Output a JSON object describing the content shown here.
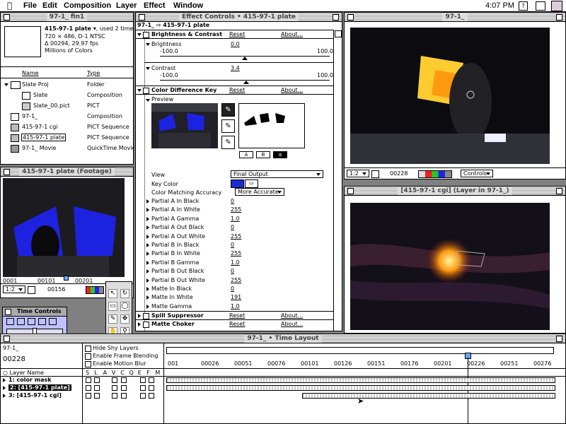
{
  "menubar": {
    "items": [
      "File",
      "Edit",
      "Composition",
      "Layer",
      "Effect",
      "Window"
    ],
    "clock": "4:07 PM"
  },
  "project": {
    "title": "97-1_ fin1",
    "selected_name": "415-97-1 plate",
    "used_times": ", used 2 times",
    "info_size": "720 × 486, D-1 NTSC",
    "info_duration": "Δ 00294, 29.97 fps",
    "info_colors": "Millions of Colors",
    "col_name": "Name",
    "col_type": "Type",
    "items": [
      {
        "name": "Slate Proj",
        "type": "Folder"
      },
      {
        "name": "Slate",
        "type": "Composition"
      },
      {
        "name": "Slate_00.pict",
        "type": "PICT"
      },
      {
        "name": "97-1_",
        "type": "Composition"
      },
      {
        "name": "415-97-1 cgi",
        "type": "PICT Sequence"
      },
      {
        "name": "415-97-1 plate",
        "type": "PICT Sequence"
      },
      {
        "name": "97-1_ Movie",
        "type": "QuickTime Movie"
      }
    ]
  },
  "footage": {
    "title": "415-97-1 plate (Footage)",
    "ruler": [
      "0001",
      "00101",
      "00201"
    ],
    "zoom": "1:2",
    "frame": "00156"
  },
  "time_controls": {
    "title": "Time Controls"
  },
  "effect_controls": {
    "title": "Effect Controls • 415-97-1 plate",
    "path": "97-1_ ⇨ 415-97-1 plate",
    "reset": "Reset",
    "about": "About...",
    "brightness": {
      "name": "Brightness & Contrast",
      "brightness_label": "Brightness",
      "brightness_value": "0.0",
      "contrast_label": "Contrast",
      "contrast_value": "3.4",
      "min": "-100.0",
      "max": "100.0"
    },
    "cdk": {
      "name": "Color Difference Key",
      "preview_label": "Preview",
      "buttons": [
        "A",
        "B",
        "α"
      ],
      "view_label": "View",
      "view_value": "Final Output",
      "key_color_label": "Key Color",
      "key_color": "#1a2bd6",
      "cma_label": "Color Matching Accuracy",
      "cma_value": "More Accurate",
      "params": [
        {
          "name": "Partial A In Black",
          "value": "0"
        },
        {
          "name": "Partial A In White",
          "value": "255"
        },
        {
          "name": "Partial A Gamma",
          "value": "1.0"
        },
        {
          "name": "Partial A Out Black",
          "value": "0"
        },
        {
          "name": "Partial A Out White",
          "value": "255"
        },
        {
          "name": "Partial B In Black",
          "value": "0"
        },
        {
          "name": "Partial B In White",
          "value": "255"
        },
        {
          "name": "Partial B Gamma",
          "value": "1.0"
        },
        {
          "name": "Partial B Out Black",
          "value": "0"
        },
        {
          "name": "Partial B Out White",
          "value": "255"
        },
        {
          "name": "Matte In Black",
          "value": "0"
        },
        {
          "name": "Matte In White",
          "value": "191"
        },
        {
          "name": "Matte Gamma",
          "value": "1.0"
        }
      ]
    },
    "spill": "Spill Suppressor",
    "choker": "Matte Choker"
  },
  "comp_window": {
    "title": "97-1_",
    "zoom": "1:2",
    "frame": "00228",
    "controls": "Controls"
  },
  "layer_window": {
    "title": "[415-97-1 cgi] (Layer in 97-1_)"
  },
  "timeline": {
    "title": "97-1_ • Time Layout",
    "comp_name": "97-1_",
    "current_frame": "00228",
    "options": [
      "Hide Shy Layers",
      "Enable Frame Blending",
      "Enable Motion Blur"
    ],
    "layer_name_header": "Layer Name",
    "switch_headers": [
      "S",
      "L",
      "A",
      "V",
      "C",
      "Q",
      "E",
      "F",
      "M"
    ],
    "layers": [
      "1: color mask",
      "2: [415-97-1 plate]",
      "3: [415-97-1 cgi]"
    ],
    "ruler": [
      "001",
      "00026",
      "00051",
      "00076",
      "00101",
      "00126",
      "00151",
      "00176",
      "00201",
      "00226",
      "00251",
      "00276"
    ]
  }
}
